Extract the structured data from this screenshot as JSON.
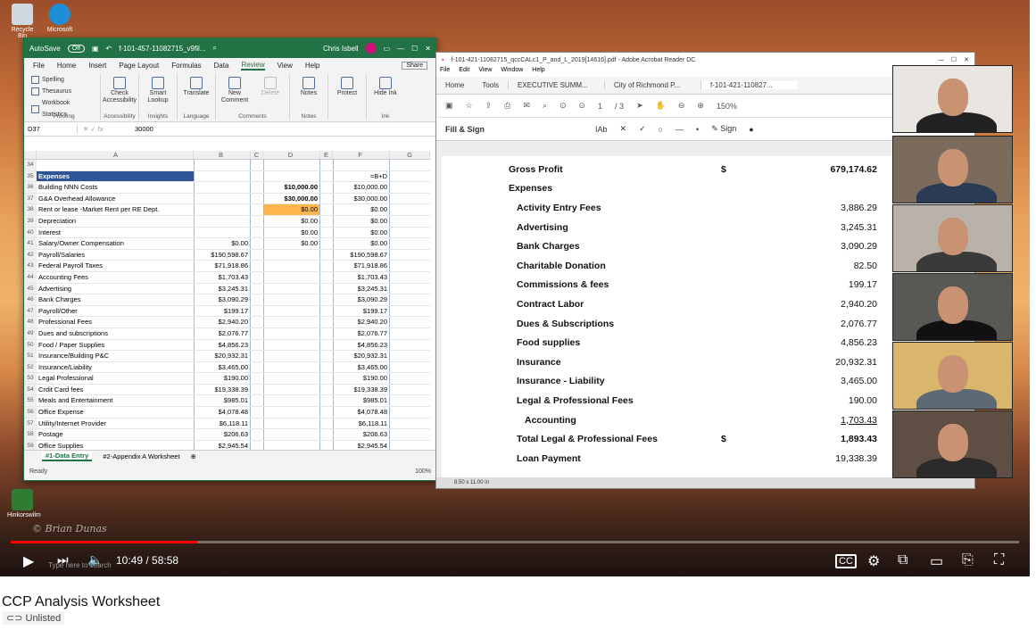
{
  "video": {
    "title": "CCP Analysis Worksheet",
    "visibility": "Unlisted",
    "time_current": "10:49",
    "time_total": "58:58",
    "progress_fraction": 0.185
  },
  "desktop": {
    "icons": [
      "Recycle Bin",
      "Microsoft",
      "Hinkorswilm"
    ],
    "taskbar_search": "Type here to search",
    "watermark": "© Brian Dunas"
  },
  "excel": {
    "autosave": "AutoSave",
    "autosave_state": "Off",
    "filename": "f-101-457-11082715_v9fil...",
    "user": "Chris Isbell",
    "menu": [
      "File",
      "Home",
      "Insert",
      "Page Layout",
      "Formulas",
      "Data",
      "Review",
      "View",
      "Help"
    ],
    "active_menu": "Review",
    "share": "Share",
    "ribbon_groups": [
      {
        "name": "Proofing",
        "items": [
          "Spelling",
          "Thesaurus",
          "Workbook Statistics"
        ]
      },
      {
        "name": "Accessibility",
        "items": [
          "Check Accessibility"
        ]
      },
      {
        "name": "Insights",
        "items": [
          "Smart Lookup"
        ]
      },
      {
        "name": "Language",
        "items": [
          "Translate"
        ]
      },
      {
        "name": "Comments",
        "items": [
          "New Comment",
          "Delete"
        ]
      },
      {
        "name": "Notes",
        "items": [
          "Notes"
        ]
      },
      {
        "name": "",
        "items": [
          "Protect"
        ]
      },
      {
        "name": "Ink",
        "items": [
          "Hide Ink"
        ]
      }
    ],
    "name_box": "D37",
    "formula": "30000",
    "columns": [
      "A",
      "B",
      "C",
      "D",
      "E",
      "F",
      "G"
    ],
    "rows": [
      {
        "n": "34",
        "a": "",
        "b": "",
        "d": "",
        "f": ""
      },
      {
        "n": "35",
        "a": "Expenses",
        "b": "",
        "d": "",
        "f": "=B+D",
        "hdr": true
      },
      {
        "n": "36",
        "a": "Building NNN Costs",
        "b": "",
        "d": "$10,000.00",
        "f": "$10,000.00",
        "bold_d": true
      },
      {
        "n": "37",
        "a": "G&A Overhead Allowance",
        "b": "",
        "d": "$30,000.00",
        "f": "$30,000.00",
        "bold_d": true
      },
      {
        "n": "38",
        "a": "Rent or lease -Market Rent per RE Dept.",
        "b": "",
        "d": "$0.00",
        "f": "$0.00",
        "orange": true
      },
      {
        "n": "39",
        "a": "Depreciation",
        "b": "",
        "d": "$0.00",
        "f": "$0.00"
      },
      {
        "n": "40",
        "a": "Interest",
        "b": "",
        "d": "$0.00",
        "f": "$0.00"
      },
      {
        "n": "41",
        "a": "Salary/Owner Compensation",
        "b": "$0.00",
        "d": "$0.00",
        "f": "$0.00"
      },
      {
        "n": "42",
        "a": "Payroll/Salaries",
        "b": "$190,598.67",
        "d": "",
        "f": "$190,598.67"
      },
      {
        "n": "43",
        "a": "Federal Payroll Taxes",
        "b": "$71,918.86",
        "d": "",
        "f": "$71,918.86"
      },
      {
        "n": "44",
        "a": "Accounting Fees",
        "b": "$1,703.43",
        "d": "",
        "f": "$1,703.43"
      },
      {
        "n": "45",
        "a": "Advertising",
        "b": "$3,245.31",
        "d": "",
        "f": "$3,245.31"
      },
      {
        "n": "46",
        "a": "Bank Charges",
        "b": "$3,090.29",
        "d": "",
        "f": "$3,090.29"
      },
      {
        "n": "47",
        "a": "Payroll/Other",
        "b": "$199.17",
        "d": "",
        "f": "$199.17"
      },
      {
        "n": "48",
        "a": "Professional Fees",
        "b": "$2,940.20",
        "d": "",
        "f": "$2,940.20"
      },
      {
        "n": "49",
        "a": "Dues and subscriptions",
        "b": "$2,076.77",
        "d": "",
        "f": "$2,076.77"
      },
      {
        "n": "50",
        "a": "Food / Paper Supplies",
        "b": "$4,856.23",
        "d": "",
        "f": "$4,856.23"
      },
      {
        "n": "51",
        "a": "Insurance/Building P&C",
        "b": "$20,932.31",
        "d": "",
        "f": "$20,932.31"
      },
      {
        "n": "52",
        "a": "Insurance/Liability",
        "b": "$3,465.00",
        "d": "",
        "f": "$3,465.00"
      },
      {
        "n": "53",
        "a": "Legal Professional",
        "b": "$190.00",
        "d": "",
        "f": "$190.00"
      },
      {
        "n": "54",
        "a": "Crdit Card fees",
        "b": "$19,338.39",
        "d": "",
        "f": "$19,338.39"
      },
      {
        "n": "55",
        "a": "Meals and Entertainment",
        "b": "$985.01",
        "d": "",
        "f": "$985.01"
      },
      {
        "n": "56",
        "a": "Office Expense",
        "b": "$4,078.48",
        "d": "",
        "f": "$4,078.48"
      },
      {
        "n": "57",
        "a": "Utility/Internet Provider",
        "b": "$6,118.11",
        "d": "",
        "f": "$6,118.11"
      },
      {
        "n": "58",
        "a": "Postage",
        "b": "$206.63",
        "d": "",
        "f": "$206.63"
      },
      {
        "n": "59",
        "a": "Office Supplies",
        "b": "$2,945.54",
        "d": "",
        "f": "$2,945.54"
      }
    ],
    "sheet_tabs": [
      "#1-Data Entry",
      "#2-Appendix A Worksheet"
    ],
    "status": "Ready",
    "zoom": "100%"
  },
  "acrobat": {
    "window_title": "f-101-421-11082715_qccCALc1_P_and_L_2019[14616].pdf - Adobe Acrobat Reader DC",
    "menu": [
      "File",
      "Edit",
      "View",
      "Window",
      "Help"
    ],
    "tabs": [
      "Home",
      "Tools",
      "EXECUTIVE SUMM...",
      "City of Richmond P...",
      "f-101-421-110827..."
    ],
    "page_current": "1",
    "page_total": "/ 3",
    "zoom": "150%",
    "fill_sign": "Fill & Sign",
    "sign": "Sign",
    "page_size": "8.50 x 11.00 in",
    "lines": [
      {
        "label": "Gross Profit",
        "dollar": "$",
        "amount": "679,174.62",
        "indent": 0,
        "bold_amt": true
      },
      {
        "label": "Expenses",
        "dollar": "",
        "amount": "",
        "indent": 0
      },
      {
        "label": "Activity Entry Fees",
        "dollar": "",
        "amount": "3,886.29",
        "indent": 1
      },
      {
        "label": "Advertising",
        "dollar": "",
        "amount": "3,245.31",
        "indent": 1
      },
      {
        "label": "Bank Charges",
        "dollar": "",
        "amount": "3,090.29",
        "indent": 1
      },
      {
        "label": "Charitable Donation",
        "dollar": "",
        "amount": "82.50",
        "indent": 1
      },
      {
        "label": "Commissions & fees",
        "dollar": "",
        "amount": "199.17",
        "indent": 1
      },
      {
        "label": "Contract Labor",
        "dollar": "",
        "amount": "2,940.20",
        "indent": 1
      },
      {
        "label": "Dues & Subscriptions",
        "dollar": "",
        "amount": "2,076.77",
        "indent": 1
      },
      {
        "label": "Food supplies",
        "dollar": "",
        "amount": "4,856.23",
        "indent": 1
      },
      {
        "label": "Insurance",
        "dollar": "",
        "amount": "20,932.31",
        "indent": 1
      },
      {
        "label": "Insurance - Liability",
        "dollar": "",
        "amount": "3,465.00",
        "indent": 1
      },
      {
        "label": "Legal & Professional Fees",
        "dollar": "",
        "amount": "190.00",
        "indent": 1
      },
      {
        "label": "Accounting",
        "dollar": "",
        "amount": "1,703.43",
        "indent": 2
      },
      {
        "label": "Total Legal & Professional Fees",
        "dollar": "$",
        "amount": "1,893.43",
        "indent": 1,
        "bold_amt": true
      },
      {
        "label": "Loan Payment",
        "dollar": "",
        "amount": "19,338.39",
        "indent": 1
      }
    ]
  }
}
